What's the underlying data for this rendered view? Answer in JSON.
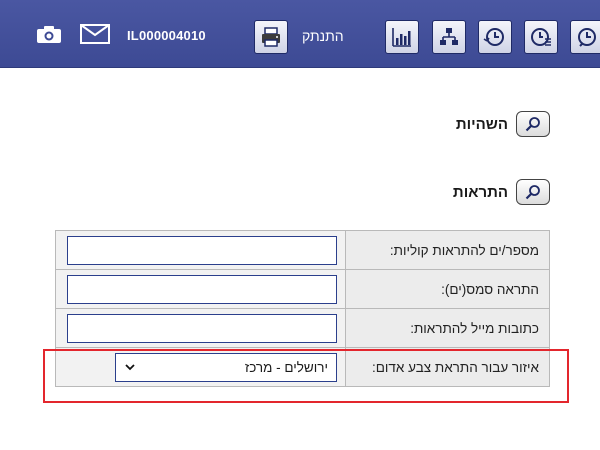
{
  "header": {
    "logout_label": "התנתק",
    "account_id": "IL000004010",
    "icons": [
      "print-icon",
      "bar-chart-icon",
      "org-chart-icon",
      "clock-money-icon",
      "clock-list-icon",
      "clock-arrow-icon",
      "mail-icon",
      "camera-icon"
    ]
  },
  "sections": {
    "delays": "השהיות",
    "alerts": "התראות"
  },
  "form": {
    "voice_label": "מספר/ים להתראות קוליות:",
    "voice_value": "",
    "sms_label": "התראה סמס(ים):",
    "sms_value": "",
    "email_label": "כתובות מייל להתראות:",
    "email_value": "",
    "region_label": "איזור עבור התראת צבע אדום:",
    "region_value": "ירושלים - מרכז"
  },
  "colors": {
    "header_bg": "#4a57a2",
    "highlight": "#e3262d",
    "input_border": "#2b3f8c"
  }
}
